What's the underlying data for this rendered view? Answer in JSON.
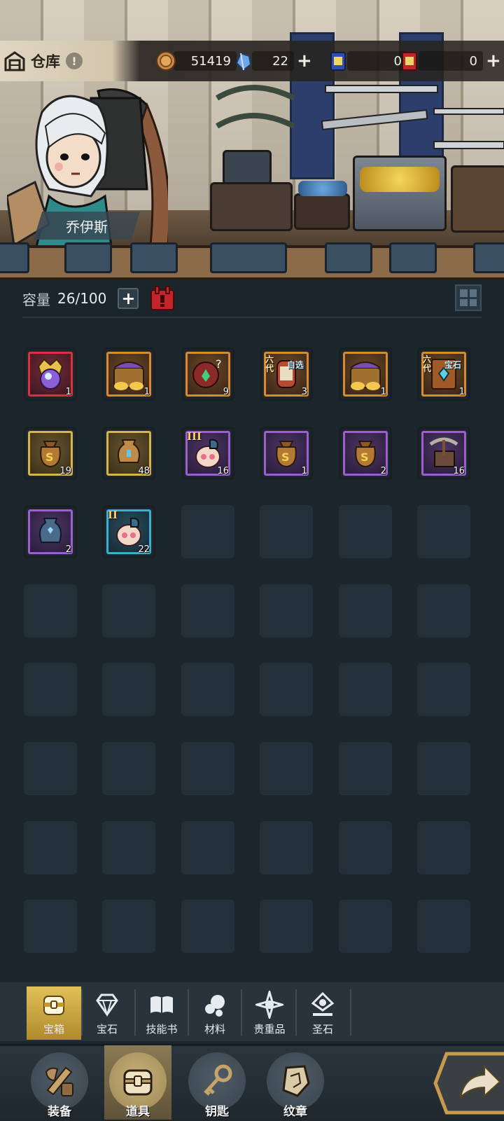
{
  "header": {
    "title": "仓库",
    "info_badge": "!",
    "resources": [
      {
        "icon": "bronze-coin-icon",
        "value": "51419",
        "has_plus": false
      },
      {
        "icon": "blue-crystal-icon",
        "value": "22",
        "has_plus": true
      },
      {
        "icon": "blue-card-icon",
        "value": "0",
        "has_plus": false
      },
      {
        "icon": "red-card-icon",
        "value": "0",
        "has_plus": true
      }
    ],
    "plus_symbol": "+"
  },
  "hero": {
    "name": "乔伊斯"
  },
  "capacity": {
    "label": "容量",
    "value": "26/100",
    "add_symbol": "+"
  },
  "items": [
    {
      "icon": "crowned-gem-orb-icon",
      "rarity": "red",
      "count": "1"
    },
    {
      "icon": "treasure-chest-gold-icon",
      "rarity": "orange",
      "count": "1"
    },
    {
      "icon": "mystery-flower-icon",
      "rarity": "orange",
      "count": "9"
    },
    {
      "icon": "choice-jar-icon",
      "rarity": "orange",
      "count": "3",
      "tag_left": "六代",
      "tag_right": "自选"
    },
    {
      "icon": "treasure-chest-gold-icon",
      "rarity": "orange",
      "count": "1"
    },
    {
      "icon": "gem-card-icon",
      "rarity": "orange",
      "count": "1",
      "tag_left": "六代",
      "tag_right": "宝石"
    },
    {
      "icon": "gold-money-bag-icon",
      "rarity": "gold",
      "count": "19"
    },
    {
      "icon": "bronze-urn-icon",
      "rarity": "gold",
      "count": "48"
    },
    {
      "icon": "tier-pouch-icon",
      "rarity": "purple",
      "count": "16",
      "tier": "III"
    },
    {
      "icon": "gold-money-bag-icon",
      "rarity": "purple",
      "count": "1"
    },
    {
      "icon": "gold-money-bag-icon",
      "rarity": "purple",
      "count": "2"
    },
    {
      "icon": "pickaxe-ore-icon",
      "rarity": "purple",
      "count": "16"
    },
    {
      "icon": "blue-urn-icon",
      "rarity": "purple",
      "count": "2"
    },
    {
      "icon": "tier-pouch-icon",
      "rarity": "blue",
      "count": "22",
      "tier": "II"
    }
  ],
  "categories": [
    {
      "label": "宝箱",
      "icon": "chest-icon",
      "active": true
    },
    {
      "label": "宝石",
      "icon": "diamond-icon",
      "active": false
    },
    {
      "label": "技能书",
      "icon": "book-icon",
      "active": false
    },
    {
      "label": "材料",
      "icon": "materials-icon",
      "active": false
    },
    {
      "label": "贵重品",
      "icon": "star-emblem-icon",
      "active": false
    },
    {
      "label": "圣石",
      "icon": "holy-stone-icon",
      "active": false
    }
  ],
  "nav": [
    {
      "label": "装备",
      "icon": "equipment-icon",
      "active": false
    },
    {
      "label": "道具",
      "icon": "item-bag-icon",
      "active": true
    },
    {
      "label": "钥匙",
      "icon": "key-icon",
      "active": false
    },
    {
      "label": "纹章",
      "icon": "emblem-icon",
      "active": false
    }
  ],
  "colors": {
    "background": "#1b252c",
    "rarity_red": "#d9323a",
    "rarity_orange": "#d98a2d",
    "rarity_gold": "#d8b24a",
    "rarity_purple": "#9b5fd0",
    "rarity_blue": "#3ab0d0",
    "active_tab": "#e2c058"
  }
}
